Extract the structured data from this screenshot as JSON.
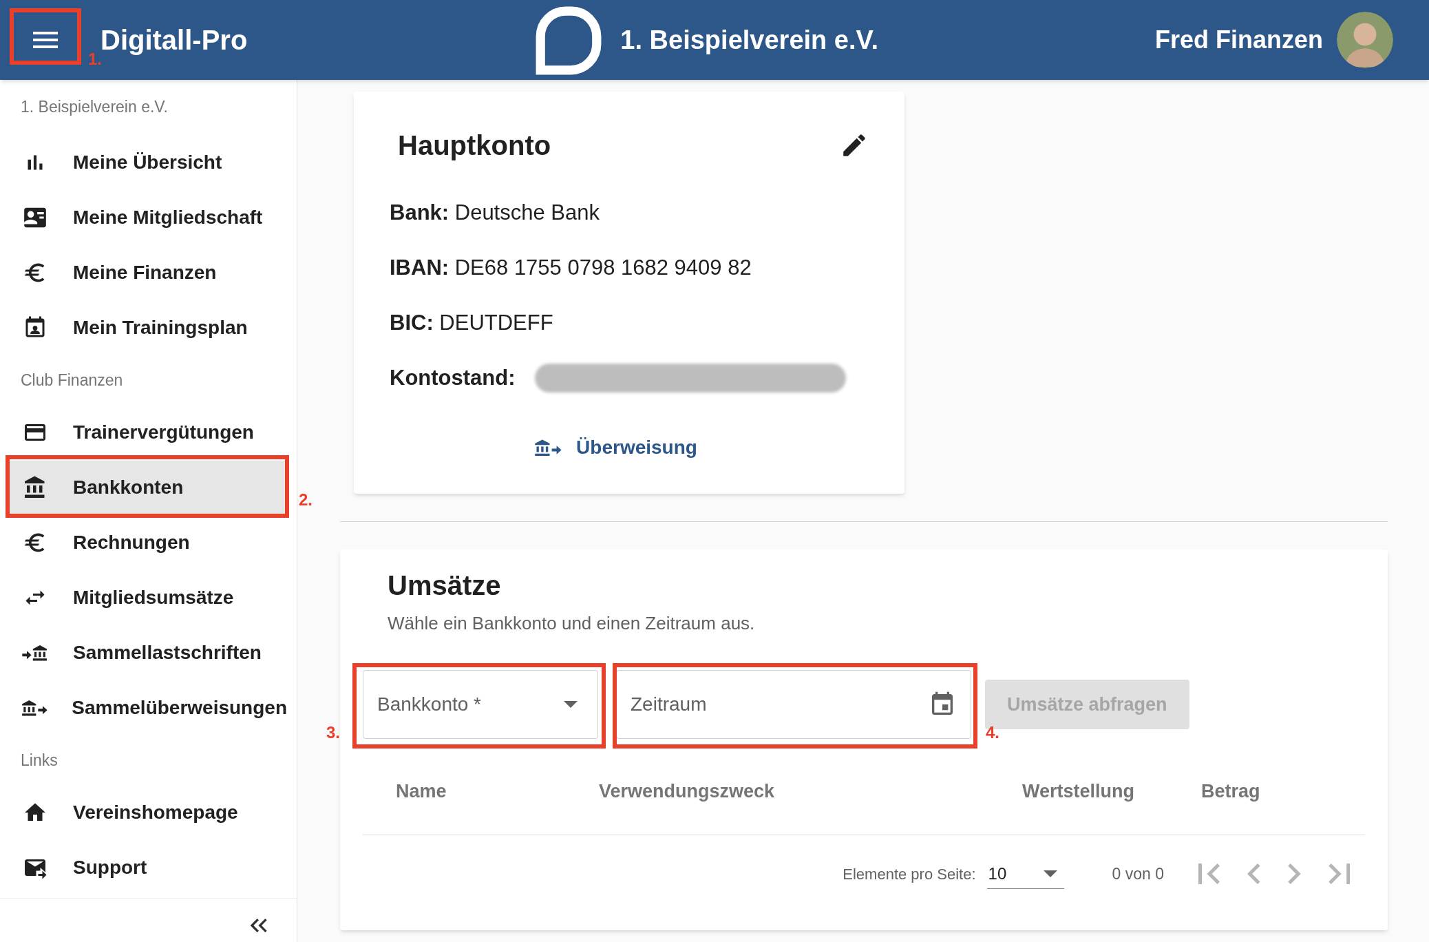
{
  "header": {
    "app_name": "Digitall-Pro",
    "club_name": "1. Beispielverein e.V.",
    "user_name": "Fred Finanzen"
  },
  "sidebar": {
    "sections": [
      {
        "heading": "1. Beispielverein e.V.",
        "items": [
          {
            "label": "Meine Übersicht",
            "selected": false
          },
          {
            "label": "Meine Mitgliedschaft",
            "selected": false
          },
          {
            "label": "Meine Finanzen",
            "selected": false
          },
          {
            "label": "Mein Trainingsplan",
            "selected": false
          }
        ]
      },
      {
        "heading": "Club Finanzen",
        "items": [
          {
            "label": "Trainervergütungen",
            "selected": false
          },
          {
            "label": "Bankkonten",
            "selected": true
          },
          {
            "label": "Rechnungen",
            "selected": false
          },
          {
            "label": "Mitgliedsumsätze",
            "selected": false
          },
          {
            "label": "Sammellastschriften",
            "selected": false
          },
          {
            "label": "Sammelüberweisungen",
            "selected": false
          }
        ]
      },
      {
        "heading": "Links",
        "items": [
          {
            "label": "Vereinshomepage",
            "selected": false
          },
          {
            "label": "Support",
            "selected": false
          }
        ]
      }
    ]
  },
  "account_card": {
    "title": "Hauptkonto",
    "fields": [
      {
        "kind": "text",
        "label": "Bank:",
        "value": "Deutsche Bank"
      },
      {
        "kind": "text",
        "label": "IBAN:",
        "value": "DE68 1755 0798 1682 9409 82"
      },
      {
        "kind": "text",
        "label": "BIC:",
        "value": "DEUTDEFF"
      },
      {
        "kind": "redacted",
        "label": "Kontostand:"
      }
    ],
    "link": "Überweisung"
  },
  "transactions": {
    "title": "Umsätze",
    "subtitle": "Wähle ein Bankkonto und einen Zeitraum aus.",
    "fields": [
      {
        "kind": "select",
        "placeholder": "Bankkonto *"
      },
      {
        "kind": "date",
        "placeholder": "Zeitraum"
      }
    ],
    "button": {
      "label": "Umsätze abfragen",
      "disabled": true
    },
    "columns": [
      "Name",
      "Verwendungszweck",
      "Wertstellung",
      "Betrag"
    ],
    "paginator": {
      "label": "Elemente pro Seite:",
      "page_size": "10",
      "range": "0 von 0"
    }
  },
  "annotations": [
    {
      "label": "1."
    },
    {
      "label": "2."
    },
    {
      "label": "3."
    },
    {
      "label": "4."
    }
  ]
}
